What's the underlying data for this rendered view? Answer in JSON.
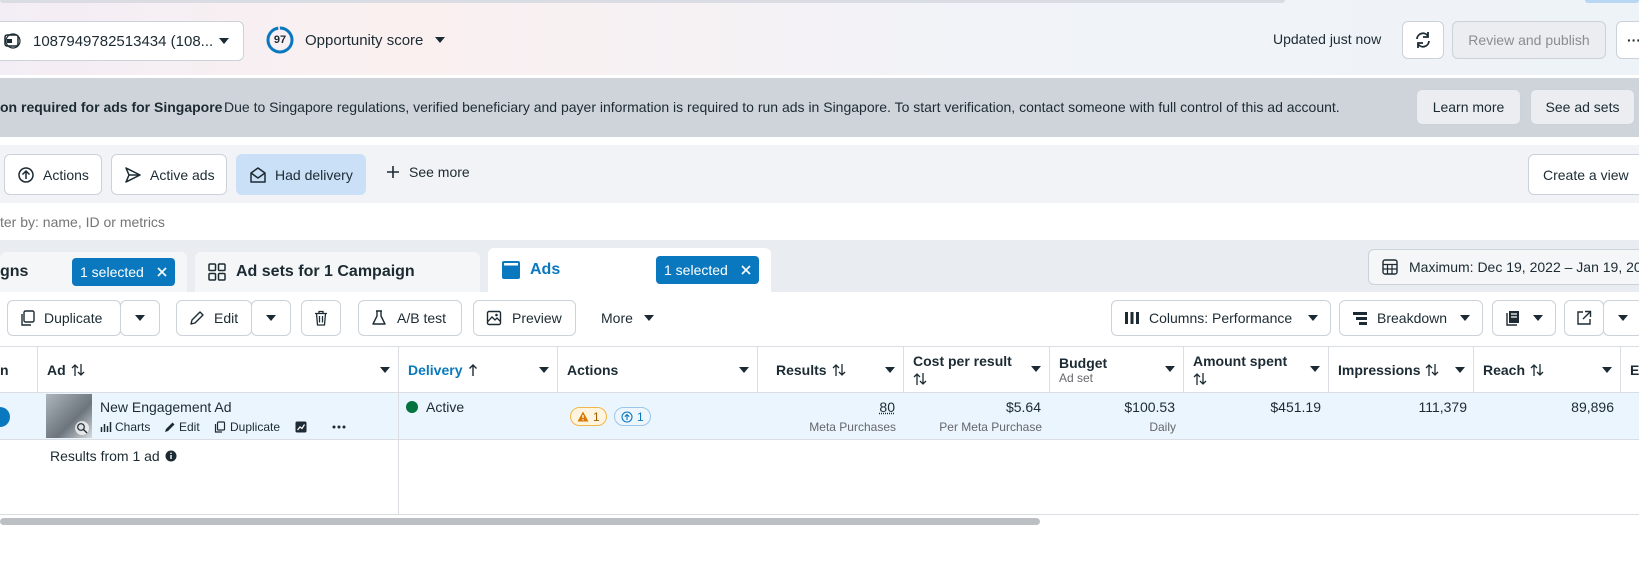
{
  "topbar": {
    "account_label": "1087949782513434 (108...",
    "score_value": "97",
    "score_label": "Opportunity score",
    "updated_text": "Updated just now",
    "review_label": "Review and publish",
    "more_glyph": "···"
  },
  "banner": {
    "title": "on required for ads for Singapore",
    "message": "Due to Singapore regulations, verified beneficiary and payer information is required to run ads in Singapore. To start verification, contact someone with full control of this ad account.",
    "learn_more": "Learn more",
    "see_ad_sets": "See ad sets"
  },
  "filters": {
    "items": [
      {
        "label": "Actions",
        "icon": "arrow-up-circle-icon"
      },
      {
        "label": "Active ads",
        "icon": "send-icon"
      },
      {
        "label": "Had delivery",
        "icon": "envelope-icon"
      },
      {
        "label": "See more",
        "icon": "plus-icon"
      }
    ],
    "create_view": "Create a view",
    "search_placeholder": "ter by: name, ID or metrics"
  },
  "tabs": {
    "campaigns_label": "gns",
    "campaigns_chip": "1 selected",
    "adsets_label": "Ad sets for 1 Campaign",
    "ads_label": "Ads",
    "ads_chip": "1 selected",
    "date_range": "Maximum: Dec 19, 2022 – Jan 19, 20"
  },
  "toolbar": {
    "duplicate": "Duplicate",
    "edit": "Edit",
    "ab_test": "A/B test",
    "preview": "Preview",
    "more": "More",
    "columns": "Columns: Performance",
    "breakdown": "Breakdown"
  },
  "table": {
    "headers": {
      "first": "n",
      "ad": "Ad",
      "delivery": "Delivery",
      "actions": "Actions",
      "results": "Results",
      "cost_per_result": "Cost per result",
      "budget": "Budget",
      "budget_sub": "Ad set",
      "amount_spent": "Amount spent",
      "impressions": "Impressions",
      "reach": "Reach",
      "last": "E"
    },
    "row": {
      "ad_name": "New Engagement Ad",
      "charts": "Charts",
      "edit": "Edit",
      "duplicate": "Duplicate",
      "delivery": "Active",
      "warn_count": "1",
      "info_count": "1",
      "results": "80",
      "results_sub": "Meta Purchases",
      "cost": "$5.64",
      "cost_sub": "Per Meta Purchase",
      "budget": "$100.53",
      "budget_sub": "Daily",
      "amount_spent": "$451.19",
      "impressions": "111,379",
      "reach": "89,896"
    },
    "footer": "Results from 1 ad"
  },
  "colors": {
    "accent": "#0a78be",
    "active_green": "#00733f",
    "warning": "#f5a623",
    "row_selected": "#ebf5fd"
  }
}
